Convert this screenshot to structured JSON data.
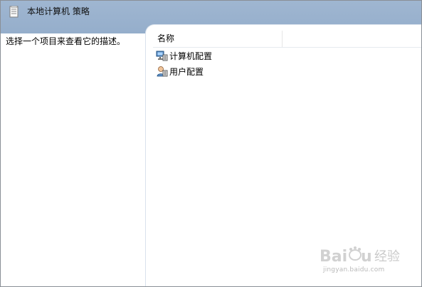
{
  "window": {
    "title": "本地计算机 策略",
    "icon": "policy-document-icon"
  },
  "description_panel": {
    "text": "选择一个项目来查看它的描述。"
  },
  "list": {
    "columns": [
      "名称"
    ],
    "items": [
      {
        "label": "计算机配置",
        "icon": "computer-config-icon"
      },
      {
        "label": "用户配置",
        "icon": "user-config-icon"
      }
    ]
  },
  "watermark": {
    "brand": "Baidu 经验",
    "url": "jingyan.baidu.com"
  },
  "colors": {
    "header_blue": "#9fb6d1",
    "border_gray": "#8a8f96",
    "watermark_gray": "#b6b6b6"
  }
}
